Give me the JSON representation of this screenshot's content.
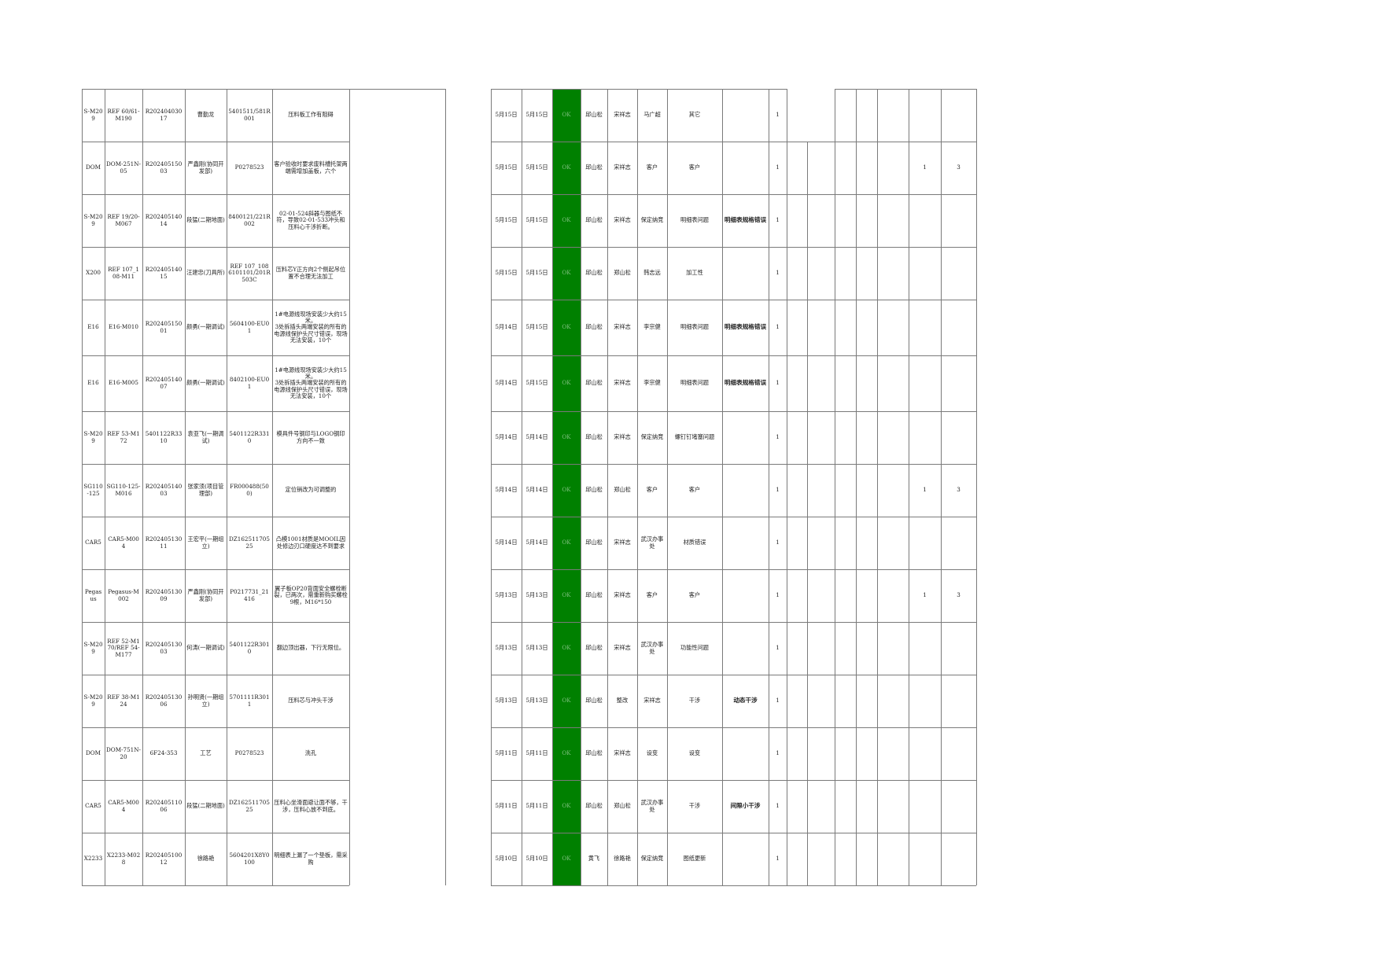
{
  "sheet": {
    "status_color": "#008000",
    "rows": [
      [
        "S-M209",
        "REF 60/61-M190",
        "R20240403017",
        "曹勤龙",
        "5401511/581R001",
        "压料板工作有阻碍",
        "",
        "",
        "5月15日",
        "5月15日",
        "OK",
        "邱山松",
        "宋祥志",
        "马广超",
        "其它",
        "",
        "1",
        "",
        "",
        "",
        "",
        "",
        "",
        ""
      ],
      [
        "DOM",
        "DOM-251N-05",
        "R20240515003",
        "严鑫刚(协同开发部)",
        "P0278523",
        "客户验收时要求废料槽托架两端需增加盖板，六个",
        "",
        "",
        "5月15日",
        "5月15日",
        "OK",
        "邱山松",
        "宋祥志",
        "客户",
        "客户",
        "",
        "1",
        "",
        "",
        "",
        "",
        "",
        "1",
        "3"
      ],
      [
        "S-M209",
        "REF 19/20-M067",
        "R20240514014",
        "段猛(二期地面)",
        "8400121/221R002",
        "02-01-524斜器与图纸不符，导致02-01-533冲头和压料心干涉折断。",
        "",
        "",
        "5月15日",
        "5月15日",
        "OK",
        "邱山松",
        "宋祥志",
        "保定纳竞",
        "明细表问题",
        "明细表规格错误",
        "1",
        "",
        "",
        "",
        "",
        "",
        "",
        ""
      ],
      [
        "X200",
        "REF 107_108-M11",
        "R20240514015",
        "汪建忠(刀具所)",
        "REF 107_108 6101101/201R503C",
        "压料芯Y正方向2个侧起吊位置不合理无法加工",
        "",
        "",
        "5月15日",
        "5月15日",
        "OK",
        "邱山松",
        "郑山松",
        "韩志远",
        "加工性",
        "",
        "1",
        "",
        "",
        "",
        "",
        "",
        "",
        ""
      ],
      [
        "E16",
        "E16-M010",
        "R20240515001",
        "颜勇(一期调试)",
        "5604100-EU01",
        "1#电源线现场安装少大约15米。\n3处拆插头两端安装的所有的电源线保护头尺寸错误，现场无法安装，10个",
        "",
        "",
        "5月14日",
        "5月15日",
        "OK",
        "邱山松",
        "宋祥志",
        "李宗健",
        "明细表问题",
        "明细表规格错误",
        "1",
        "",
        "",
        "",
        "",
        "",
        "",
        ""
      ],
      [
        "E16",
        "E16-M005",
        "R20240514007",
        "颜勇(一期调试)",
        "8402100-EU01",
        "1#电源线现场安装少大约15米。\n3处拆插头两端安装的所有的电源线保护头尺寸错误，现场无法安装，10个",
        "",
        "",
        "5月14日",
        "5月15日",
        "OK",
        "邱山松",
        "宋祥志",
        "李宗健",
        "明细表问题",
        "明细表规格错误",
        "1",
        "",
        "",
        "",
        "",
        "",
        "",
        ""
      ],
      [
        "S-M209",
        "REF 53-M172",
        "5401122R3310",
        "袁亚飞(一期调试)",
        "5401122R3310",
        "模具件号钢印与LOGO钢印方向不一致",
        "",
        "",
        "5月14日",
        "5月14日",
        "OK",
        "邱山松",
        "宋祥志",
        "保定纳竞",
        "螺钉钉堵塞问题",
        "",
        "1",
        "",
        "",
        "",
        "",
        "",
        "",
        ""
      ],
      [
        "SG110-125",
        "SG110-125-M016",
        "R20240514003",
        "张家须(项目管理部)",
        "FR000488(500)",
        "定位销改为可调整的",
        "",
        "",
        "5月14日",
        "5月14日",
        "OK",
        "邱山松",
        "郑山松",
        "客户",
        "客户",
        "",
        "1",
        "",
        "",
        "",
        "",
        "",
        "1",
        "3"
      ],
      [
        "CAR5",
        "CAR5-M004",
        "R20240513011",
        "王宏平(一期组立)",
        "DZ16251170525",
        "凸模1001材质是MOOIL因处修边刃口硬度达不到要求",
        "",
        "",
        "5月14日",
        "5月14日",
        "OK",
        "邱山松",
        "宋祥志",
        "武汉办事处",
        "材质错误",
        "",
        "1",
        "",
        "",
        "",
        "",
        "",
        "",
        ""
      ],
      [
        "Pegasus",
        "Pegasus-M002",
        "R20240513009",
        "严鑫刚(协同开发部)",
        "P0217731_21416",
        "翼子板OP20背面安全螺栓断裂，已两次，需重新购买螺栓9根，M16*150",
        "",
        "",
        "5月13日",
        "5月13日",
        "OK",
        "邱山松",
        "宋祥志",
        "客户",
        "客户",
        "",
        "1",
        "",
        "",
        "",
        "",
        "",
        "1",
        "3"
      ],
      [
        "S-M209",
        "REF 52-M170/REF 54-M177",
        "R20240513003",
        "何涛(一期调试)",
        "5401122R3010",
        "翻边顶出器，下行无限位。",
        "",
        "",
        "5月13日",
        "5月13日",
        "OK",
        "邱山松",
        "宋祥志",
        "武汉办事处",
        "功能性问题",
        "",
        "1",
        "",
        "",
        "",
        "",
        "",
        "",
        ""
      ],
      [
        "S-M209",
        "REF 38-M124",
        "R20240513006",
        "孙明贤(一期组立)",
        "5701111R3011",
        "压料芯与冲头干涉",
        "",
        "",
        "5月13日",
        "5月13日",
        "OK",
        "邱山松",
        "整改",
        "宋祥志",
        "干涉",
        "动态干涉",
        "1",
        "",
        "",
        "",
        "",
        "",
        "",
        ""
      ],
      [
        "DOM",
        "DOM-751N-20",
        "6F24-353",
        "工艺",
        "P0278523",
        "洗孔",
        "",
        "",
        "5月11日",
        "5月11日",
        "OK",
        "邱山松",
        "宋祥志",
        "设变",
        "设变",
        "",
        "1",
        "",
        "",
        "",
        "",
        "",
        "",
        ""
      ],
      [
        "CAR5",
        "CAR5-M004",
        "R20240511006",
        "段猛(二期地面)",
        "DZ16251170525",
        "压料心坐滑面避让面不够，干涉，压料心放不到底。",
        "",
        "",
        "5月11日",
        "5月11日",
        "OK",
        "邱山松",
        "郑山松",
        "武汉办事处",
        "干涉",
        "间隙小干涉",
        "1",
        "",
        "",
        "",
        "",
        "",
        "",
        ""
      ],
      [
        "X2233",
        "X2233-M028",
        "R20240510012",
        "徐路艳",
        "5604201X8Y0100",
        "明细表上漏了一个垫板，需采购",
        "",
        "",
        "5月10日",
        "5月10日",
        "OK",
        "黄飞",
        "徐路艳",
        "保定纳竞",
        "图纸更新",
        "",
        "1",
        "",
        "",
        "",
        "",
        "",
        "",
        ""
      ]
    ]
  }
}
